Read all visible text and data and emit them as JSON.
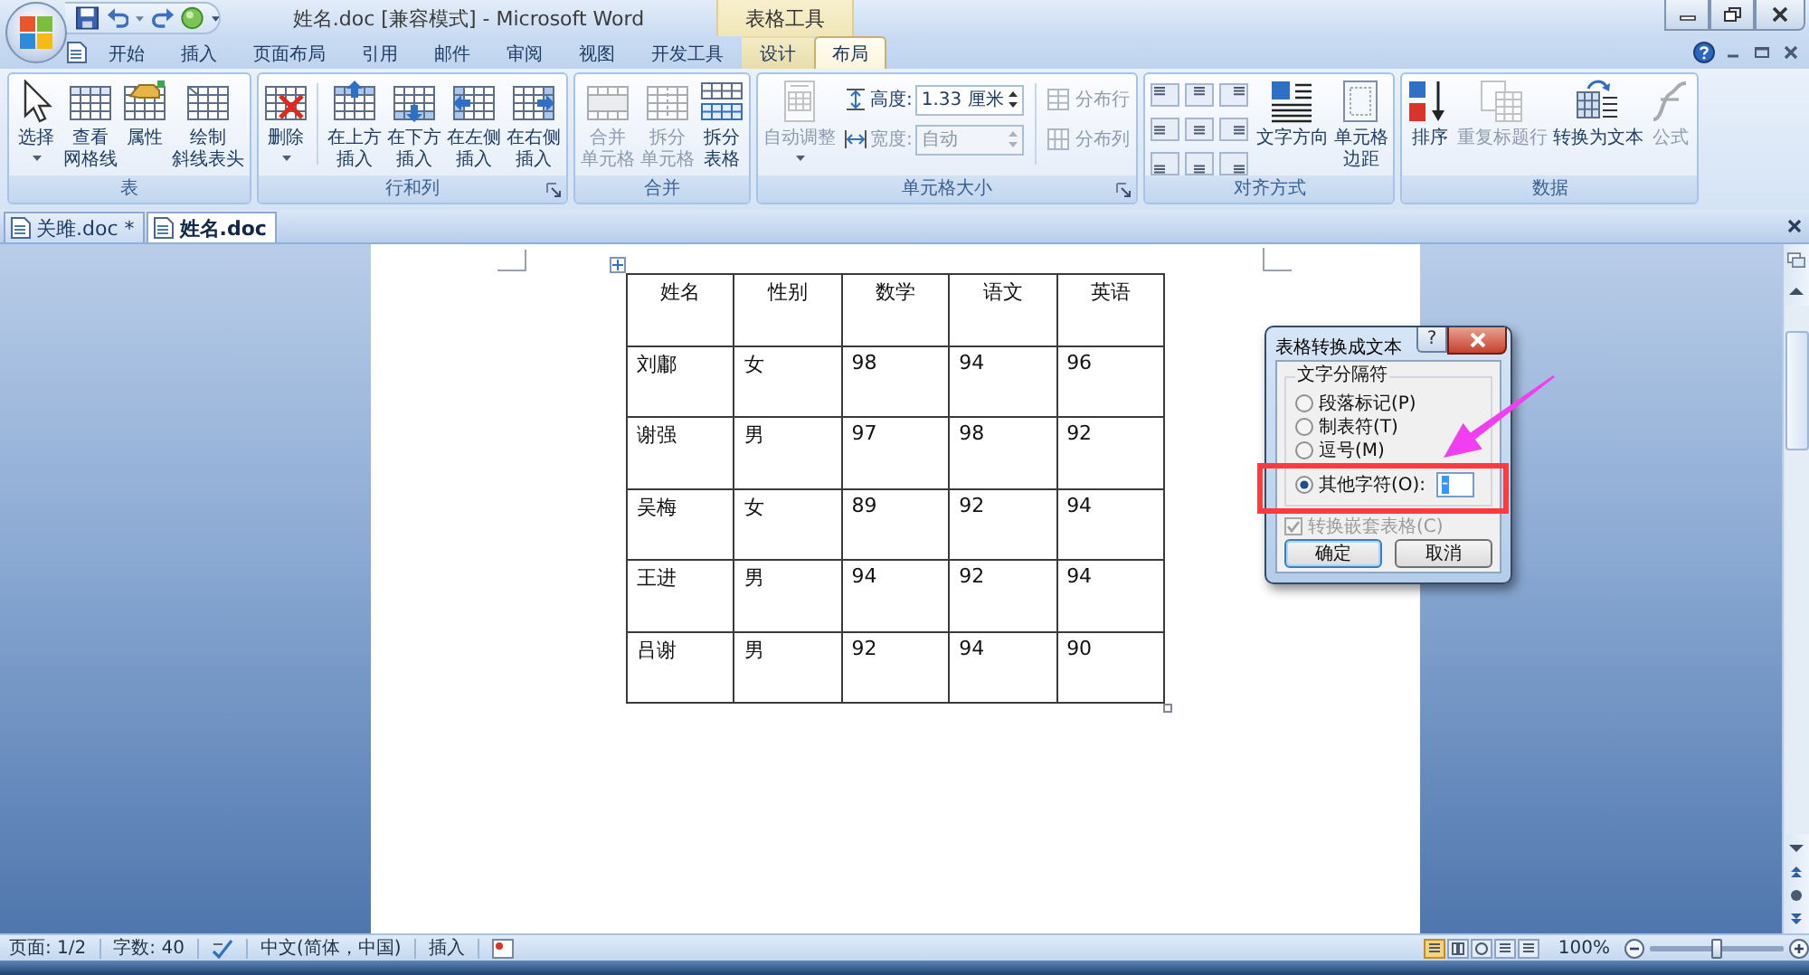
{
  "window": {
    "title": "姓名.doc [兼容模式] - Microsoft Word",
    "context_header": "表格工具"
  },
  "ribbon_tabs": [
    {
      "label": "开始",
      "selected": false,
      "contextual": false
    },
    {
      "label": "插入",
      "selected": false,
      "contextual": false
    },
    {
      "label": "页面布局",
      "selected": false,
      "contextual": false
    },
    {
      "label": "引用",
      "selected": false,
      "contextual": false
    },
    {
      "label": "邮件",
      "selected": false,
      "contextual": false
    },
    {
      "label": "审阅",
      "selected": false,
      "contextual": false
    },
    {
      "label": "视图",
      "selected": false,
      "contextual": false
    },
    {
      "label": "开发工具",
      "selected": false,
      "contextual": false
    },
    {
      "label": "设计",
      "selected": false,
      "contextual": true
    },
    {
      "label": "布局",
      "selected": true,
      "contextual": true
    }
  ],
  "ribbon_groups": [
    {
      "title": "表",
      "launcher": false,
      "controls": [
        {
          "kind": "large",
          "lines": [
            "选择"
          ],
          "dropdown": true,
          "disabled": false
        },
        {
          "kind": "large",
          "lines": [
            "查看",
            "网格线"
          ],
          "dropdown": false,
          "disabled": false
        },
        {
          "kind": "large",
          "lines": [
            "属性"
          ],
          "dropdown": false,
          "disabled": false
        },
        {
          "kind": "large",
          "lines": [
            "绘制",
            "斜线表头"
          ],
          "dropdown": false,
          "disabled": false
        }
      ]
    },
    {
      "title": "行和列",
      "launcher": true,
      "controls": [
        {
          "kind": "large",
          "lines": [
            "删除"
          ],
          "dropdown": true,
          "disabled": false
        },
        {
          "kind": "divider"
        },
        {
          "kind": "large",
          "lines": [
            "在上方",
            "插入"
          ],
          "dropdown": false,
          "disabled": false
        },
        {
          "kind": "large",
          "lines": [
            "在下方",
            "插入"
          ],
          "dropdown": false,
          "disabled": false
        },
        {
          "kind": "large",
          "lines": [
            "在左侧",
            "插入"
          ],
          "dropdown": false,
          "disabled": false
        },
        {
          "kind": "large",
          "lines": [
            "在右侧",
            "插入"
          ],
          "dropdown": false,
          "disabled": false
        }
      ]
    },
    {
      "title": "合并",
      "launcher": false,
      "controls": [
        {
          "kind": "large",
          "lines": [
            "合并",
            "单元格"
          ],
          "dropdown": false,
          "disabled": true
        },
        {
          "kind": "large",
          "lines": [
            "拆分",
            "单元格"
          ],
          "dropdown": false,
          "disabled": true
        },
        {
          "kind": "large",
          "lines": [
            "拆分",
            "表格"
          ],
          "dropdown": false,
          "disabled": false
        }
      ]
    },
    {
      "title": "单元格大小",
      "launcher": true,
      "controls": [
        {
          "kind": "large",
          "lines": [
            "自动调整"
          ],
          "dropdown": true,
          "disabled": true
        },
        {
          "kind": "fields",
          "items": [
            {
              "label": "高度:",
              "value": "1.33 厘米",
              "disabled": false
            },
            {
              "label": "宽度:",
              "value": "自动",
              "disabled": true
            }
          ]
        },
        {
          "kind": "divider"
        },
        {
          "kind": "small_stack",
          "items": [
            {
              "label": "分布行",
              "disabled": true
            },
            {
              "label": "分布列",
              "disabled": true
            }
          ]
        }
      ]
    },
    {
      "title": "对齐方式",
      "launcher": false,
      "controls": [
        {
          "kind": "align_grid"
        },
        {
          "kind": "large",
          "lines": [
            "文字方向"
          ],
          "dropdown": false,
          "disabled": false
        },
        {
          "kind": "large",
          "lines": [
            "单元格",
            "边距"
          ],
          "dropdown": false,
          "disabled": false
        }
      ]
    },
    {
      "title": "数据",
      "launcher": false,
      "controls": [
        {
          "kind": "large",
          "lines": [
            "排序"
          ],
          "dropdown": false,
          "disabled": false
        },
        {
          "kind": "large",
          "lines": [
            "重复标题行"
          ],
          "dropdown": false,
          "disabled": true
        },
        {
          "kind": "large",
          "lines": [
            "转换为文本"
          ],
          "dropdown": false,
          "disabled": false
        },
        {
          "kind": "large",
          "lines": [
            "公式"
          ],
          "dropdown": false,
          "disabled": true
        }
      ]
    }
  ],
  "document_tabs": [
    {
      "label": "关雎.doc *",
      "selected": false
    },
    {
      "label": "姓名.doc",
      "selected": true
    }
  ],
  "document": {
    "table": {
      "columns": [
        "姓名",
        "性别",
        "数学",
        "语文",
        "英语"
      ],
      "rows": [
        [
          "刘鄘",
          "女",
          "98",
          "94",
          "96"
        ],
        [
          "谢强",
          "男",
          "97",
          "98",
          "92"
        ],
        [
          "吴梅",
          "女",
          "89",
          "92",
          "94"
        ],
        [
          "王进",
          "男",
          "94",
          "92",
          "94"
        ],
        [
          "吕谢",
          "男",
          "92",
          "94",
          "90"
        ]
      ]
    }
  },
  "dialog": {
    "title": "表格转换成文本",
    "help": "?",
    "group_title": "文字分隔符",
    "options": [
      {
        "label": "段落标记(P)",
        "selected": false
      },
      {
        "label": "制表符(T)",
        "selected": false
      },
      {
        "label": "逗号(M)",
        "selected": false
      },
      {
        "label": "其他字符(O):",
        "selected": true,
        "value": "-"
      }
    ],
    "nested": {
      "label": "转换嵌套表格(C)",
      "checked": true,
      "disabled": true
    },
    "buttons": [
      {
        "label": "确定",
        "default": true
      },
      {
        "label": "取消",
        "default": false
      }
    ]
  },
  "status_bar": {
    "page": "页面: 1/2",
    "words": "字数: 40",
    "language": "中文(简体，中国)",
    "mode": "插入",
    "views": [
      {
        "selected": true
      },
      {
        "selected": false
      },
      {
        "selected": false
      },
      {
        "selected": false
      },
      {
        "selected": false
      }
    ],
    "zoom": "100%",
    "zoom_slider": {
      "level": 0.5
    }
  }
}
